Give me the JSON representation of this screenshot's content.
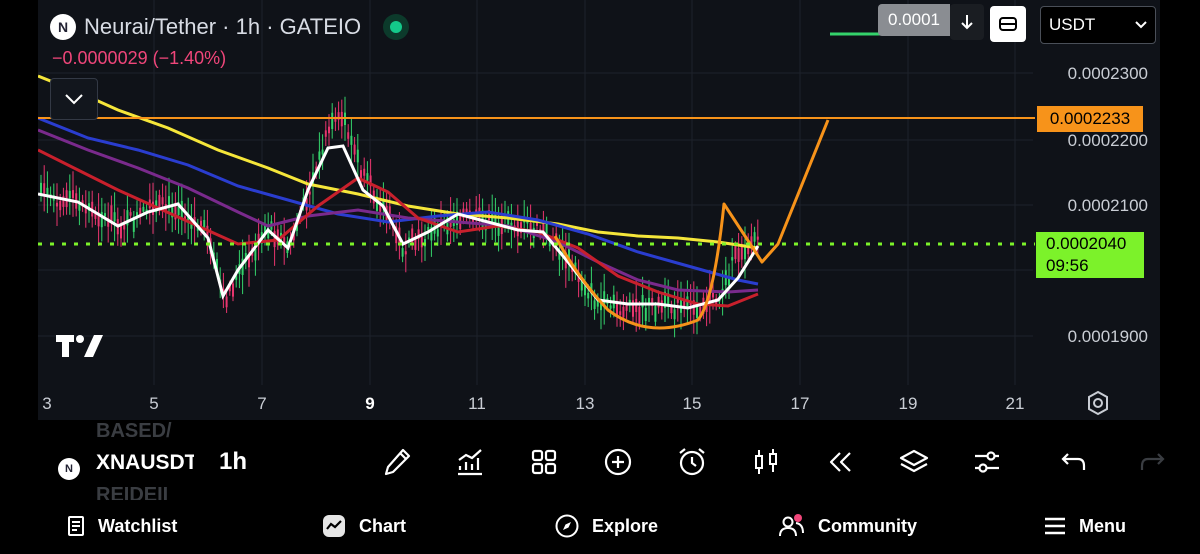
{
  "header": {
    "title": "Neurai/Tether · 1h · GATEIO",
    "logo_letter": "N",
    "change": "−0.0000029 (−1.40%)"
  },
  "toolbar_top": {
    "price_input": "0.0001",
    "currency": "USDT"
  },
  "price_axis": [
    "0.0002300",
    "0.0002200",
    "0.0002100",
    "0.0001900"
  ],
  "time_axis": [
    "3",
    "5",
    "7",
    "9",
    "11",
    "13",
    "15",
    "17",
    "19",
    "21"
  ],
  "markers": {
    "alert_price": "0.0002233",
    "last_price": "0.0002040",
    "countdown": "09:56"
  },
  "symbol_bar": {
    "ghost_above": "BASED/",
    "ghost_below": "REIDEII",
    "symbol": "XNAUSDT",
    "interval": "1h"
  },
  "tools": [
    "pencil-icon",
    "line-chart-icon",
    "grid-icon",
    "add-circle-icon",
    "alarm-icon",
    "candles-icon",
    "replay-icon",
    "layers-icon",
    "sliders-icon",
    "undo-icon",
    "redo-icon"
  ],
  "nav": {
    "watchlist": "Watchlist",
    "chart": "Chart",
    "explore": "Explore",
    "community": "Community",
    "menu": "Menu"
  },
  "colors": {
    "background": "#0f1218",
    "up": "#34d36b",
    "down": "#e8356e",
    "alert_line": "#f7931a",
    "last_line": "#7cf22a",
    "ma_yellow": "#f5e63a",
    "ma_white": "#ffffff",
    "ma_red": "#c8202c",
    "ma_blue": "#2a3dcf",
    "ma_purple": "#7a2a8c"
  }
}
